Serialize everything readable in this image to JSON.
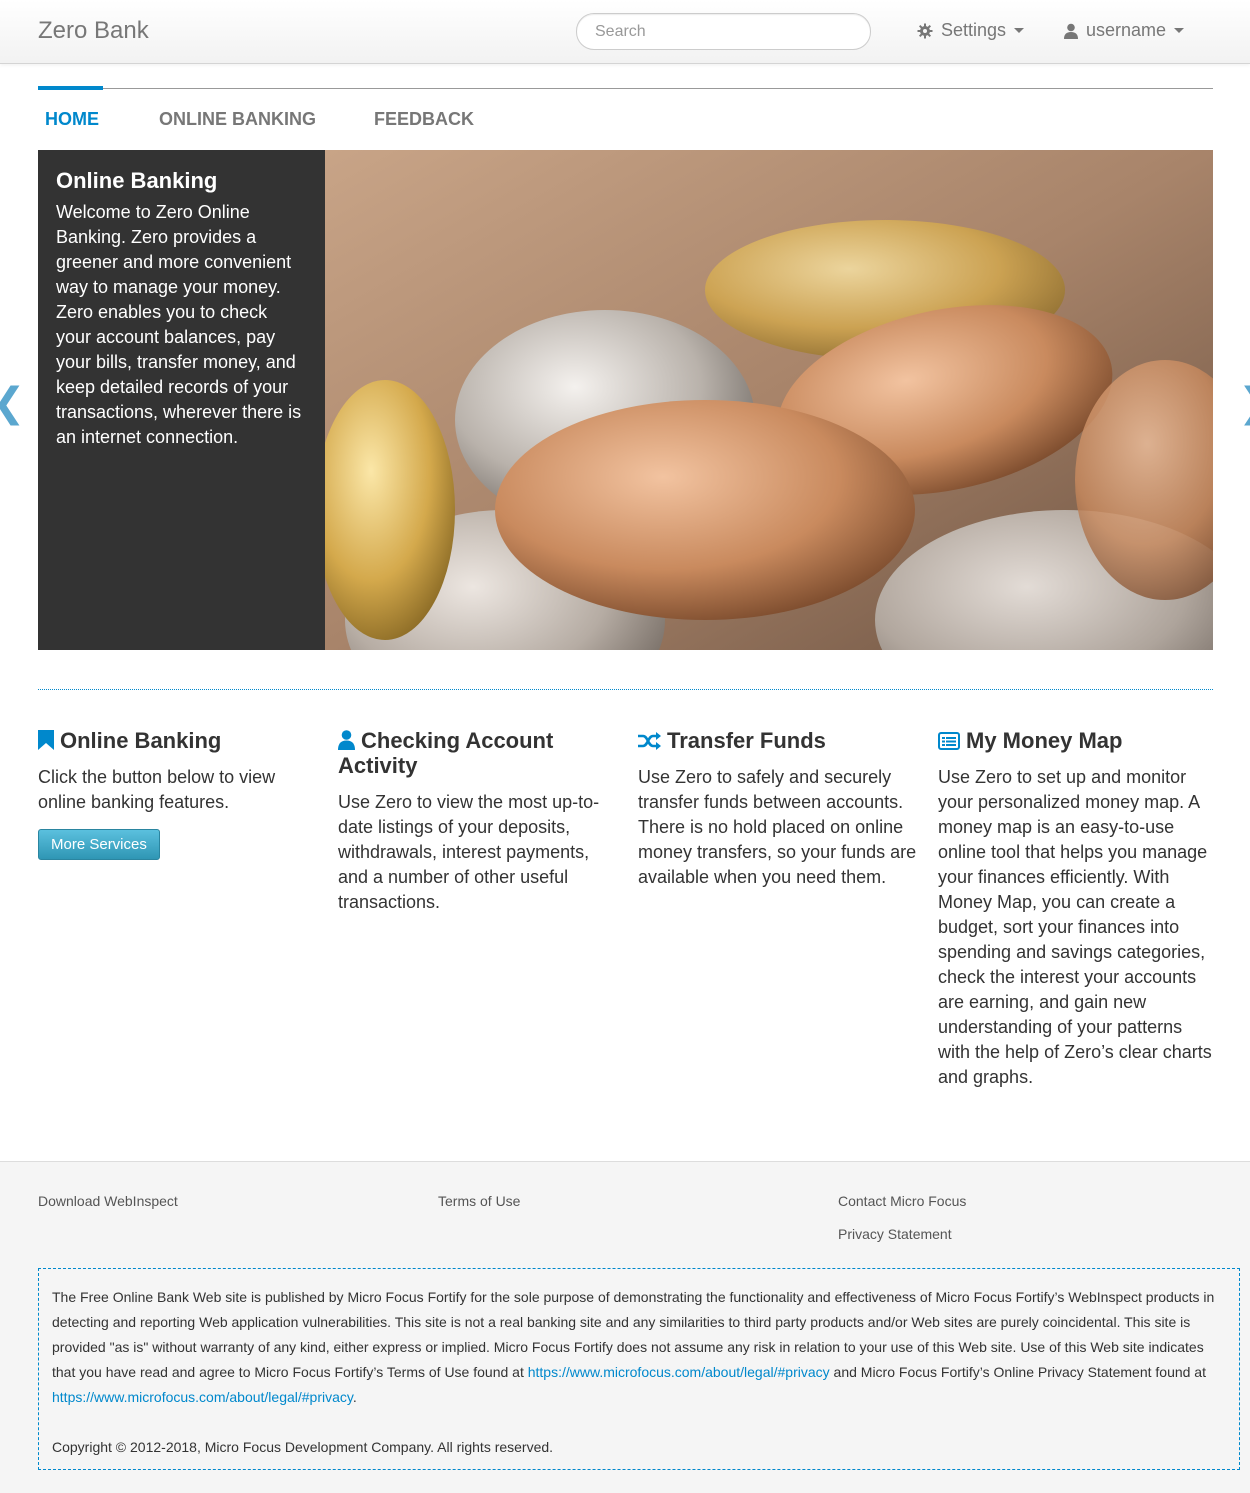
{
  "navbar": {
    "brand": "Zero Bank",
    "search_placeholder": "Search",
    "settings_label": "Settings",
    "user_label": "username"
  },
  "tabs": [
    {
      "label": "HOME",
      "active": true
    },
    {
      "label": "ONLINE BANKING",
      "active": false
    },
    {
      "label": "FEEDBACK",
      "active": false
    }
  ],
  "hero": {
    "title": "Online Banking",
    "text": "Welcome to Zero Online Banking. Zero provides a greener and more convenient way to manage your money. Zero enables you to check your account balances, pay your bills, transfer money, and keep detailed records of your transactions, wherever there is an internet connection.",
    "prev_arrow": "❮",
    "next_arrow": "❯"
  },
  "features": [
    {
      "title": "Online Banking",
      "icon": "bookmark-icon",
      "text": "Click the button below to view online banking features.",
      "button": "More Services"
    },
    {
      "title": "Checking Account Activity",
      "icon": "user-icon",
      "text": "Use Zero to view the most up-to-date listings of your deposits, withdrawals, interest payments, and a number of other useful transactions."
    },
    {
      "title": "Transfer Funds",
      "icon": "shuffle-icon",
      "text": "Use Zero to safely and securely transfer funds between accounts. There is no hold placed on online money transfers, so your funds are available when you need them."
    },
    {
      "title": "My Money Map",
      "icon": "list-alt-icon",
      "text": "Use Zero to set up and monitor your personalized money map. A money map is an easy-to-use online tool that helps you manage your finances efficiently. With Money Map, you can create a budget, sort your finances into spending and savings categories, check the interest your accounts are earning, and gain new understanding of your patterns with the help of Zero’s clear charts and graphs."
    }
  ],
  "footer": {
    "links": [
      "Download WebInspect",
      "Terms of Use",
      "Contact Micro Focus",
      "Privacy Statement"
    ],
    "disclaimer_1": "The Free Online Bank Web site is published by Micro Focus Fortify for the sole purpose of demonstrating the functionality and effectiveness of Micro Focus Fortify’s WebInspect products in detecting and reporting Web application vulnerabilities. This site is not a real banking site and any similarities to third party products and/or Web sites are purely coincidental. This site is provided \"as is\" without warranty of any kind, either express or implied. Micro Focus Fortify does not assume any risk in relation to your use of this Web site. Use of this Web site indicates that you have read and agree to Micro Focus Fortify’s Terms of Use found at ",
    "link_1": "https://www.microfocus.com/about/legal/#privacy",
    "disclaimer_2": " and Micro Focus Fortify’s Online Privacy Statement found at ",
    "link_2": "https://www.microfocus.com/about/legal/#privacy",
    "disclaimer_3": ".",
    "copyright": "Copyright © 2012-2018, Micro Focus Development Company. All rights reserved."
  },
  "colors": {
    "accent": "#0088cc",
    "hero_panel": "#333333",
    "button": "#49afcd"
  }
}
